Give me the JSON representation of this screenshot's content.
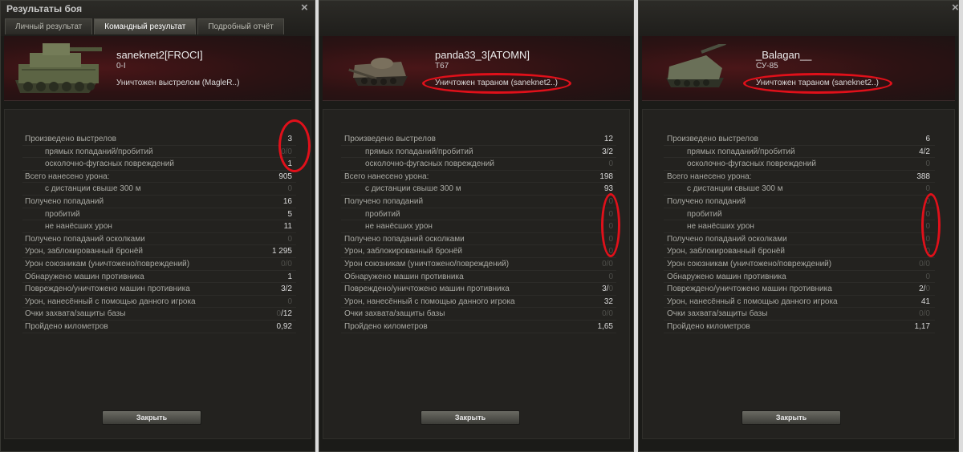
{
  "window": {
    "title": "Результаты боя",
    "close_icon": "×",
    "tabs": [
      {
        "label": "Личный результат",
        "active": false
      },
      {
        "label": "Командный результат",
        "active": true
      },
      {
        "label": "Подробный отчёт",
        "active": false
      }
    ]
  },
  "ui": {
    "close_label": "Закрыть"
  },
  "colors": {
    "highlight": "#e0101a",
    "header_red": "#4a1618"
  },
  "panels": [
    {
      "player": "saneknet2[FROCI]",
      "vehicle": "0-I",
      "vehicle_icon": "heavy-tank-icon",
      "fate": "Уничтожен выстрелом (MagleR..)",
      "stats": [
        {
          "label": "Произведено выстрелов",
          "indent": false,
          "value": "3",
          "dim": ""
        },
        {
          "label": "прямых попаданий/пробитий",
          "indent": true,
          "value": "",
          "dim": "0/0"
        },
        {
          "label": "осколочно-фугасных повреждений",
          "indent": true,
          "value": "1",
          "dim": ""
        },
        {
          "label": "Всего нанесено урона:",
          "indent": false,
          "value": "905",
          "dim": ""
        },
        {
          "label": "с дистанции свыше 300 м",
          "indent": true,
          "value": "",
          "dim": "0"
        },
        {
          "label": "Получено попаданий",
          "indent": false,
          "value": "16",
          "dim": ""
        },
        {
          "label": "пробитий",
          "indent": true,
          "value": "5",
          "dim": ""
        },
        {
          "label": "не нанёсших урон",
          "indent": true,
          "value": "11",
          "dim": ""
        },
        {
          "label": "Получено попаданий осколками",
          "indent": false,
          "value": "",
          "dim": "0"
        },
        {
          "label": "Урон, заблокированный бронёй",
          "indent": false,
          "value": "1 295",
          "dim": ""
        },
        {
          "label": "Урон союзникам (уничтожено/повреждений)",
          "indent": false,
          "value": "",
          "dim": "0/0"
        },
        {
          "label": "Обнаружено машин противника",
          "indent": false,
          "value": "1",
          "dim": ""
        },
        {
          "label": "Повреждено/уничтожено машин противника",
          "indent": false,
          "value": "3/2",
          "dim": ""
        },
        {
          "label": "Урон, нанесённый с помощью данного игрока",
          "indent": false,
          "value": "",
          "dim": "0"
        },
        {
          "label": "Очки захвата/защиты базы",
          "indent": false,
          "value": "/12",
          "dim": "0"
        },
        {
          "label": "Пройдено километров",
          "indent": false,
          "value": "0,92",
          "dim": ""
        }
      ]
    },
    {
      "player": "panda33_3[ATOMN]",
      "vehicle": "T67",
      "vehicle_icon": "tank-destroyer-icon",
      "fate": "Уничтожен тараном (saneknet2..)",
      "stats": [
        {
          "label": "Произведено выстрелов",
          "indent": false,
          "value": "12",
          "dim": ""
        },
        {
          "label": "прямых попаданий/пробитий",
          "indent": true,
          "value": "3/2",
          "dim": ""
        },
        {
          "label": "осколочно-фугасных повреждений",
          "indent": true,
          "value": "",
          "dim": "0"
        },
        {
          "label": "Всего нанесено урона:",
          "indent": false,
          "value": "198",
          "dim": ""
        },
        {
          "label": "с дистанции свыше 300 м",
          "indent": true,
          "value": "93",
          "dim": ""
        },
        {
          "label": "Получено попаданий",
          "indent": false,
          "value": "",
          "dim": "0"
        },
        {
          "label": "пробитий",
          "indent": true,
          "value": "",
          "dim": "0"
        },
        {
          "label": "не нанёсших урон",
          "indent": true,
          "value": "",
          "dim": "0"
        },
        {
          "label": "Получено попаданий осколками",
          "indent": false,
          "value": "",
          "dim": "0"
        },
        {
          "label": "Урон, заблокированный бронёй",
          "indent": false,
          "value": "",
          "dim": "0"
        },
        {
          "label": "Урон союзникам (уничтожено/повреждений)",
          "indent": false,
          "value": "",
          "dim": "0/0"
        },
        {
          "label": "Обнаружено машин противника",
          "indent": false,
          "value": "",
          "dim": "0"
        },
        {
          "label": "Повреждено/уничтожено машин противника",
          "indent": false,
          "value": "3/",
          "dim": "0"
        },
        {
          "label": "Урон, нанесённый с помощью данного игрока",
          "indent": false,
          "value": "32",
          "dim": ""
        },
        {
          "label": "Очки захвата/защиты базы",
          "indent": false,
          "value": "",
          "dim": "0/0"
        },
        {
          "label": "Пройдено километров",
          "indent": false,
          "value": "1,65",
          "dim": ""
        }
      ]
    },
    {
      "player": "_Balagan__",
      "vehicle": "СУ-85",
      "vehicle_icon": "self-propelled-gun-icon",
      "fate": "Уничтожен тараном (saneknet2..)",
      "stats": [
        {
          "label": "Произведено выстрелов",
          "indent": false,
          "value": "6",
          "dim": ""
        },
        {
          "label": "прямых попаданий/пробитий",
          "indent": true,
          "value": "4/2",
          "dim": ""
        },
        {
          "label": "осколочно-фугасных повреждений",
          "indent": true,
          "value": "",
          "dim": "0"
        },
        {
          "label": "Всего нанесено урона:",
          "indent": false,
          "value": "388",
          "dim": ""
        },
        {
          "label": "с дистанции свыше 300 м",
          "indent": true,
          "value": "",
          "dim": "0"
        },
        {
          "label": "Получено попаданий",
          "indent": false,
          "value": "",
          "dim": "0"
        },
        {
          "label": "пробитий",
          "indent": true,
          "value": "",
          "dim": "0"
        },
        {
          "label": "не нанёсших урон",
          "indent": true,
          "value": "",
          "dim": "0"
        },
        {
          "label": "Получено попаданий осколками",
          "indent": false,
          "value": "",
          "dim": "0"
        },
        {
          "label": "Урон, заблокированный бронёй",
          "indent": false,
          "value": "",
          "dim": "0"
        },
        {
          "label": "Урон союзникам (уничтожено/повреждений)",
          "indent": false,
          "value": "",
          "dim": "0/0"
        },
        {
          "label": "Обнаружено машин противника",
          "indent": false,
          "value": "",
          "dim": "0"
        },
        {
          "label": "Повреждено/уничтожено машин противника",
          "indent": false,
          "value": "2/",
          "dim": "0"
        },
        {
          "label": "Урон, нанесённый с помощью данного игрока",
          "indent": false,
          "value": "41",
          "dim": ""
        },
        {
          "label": "Очки захвата/защиты базы",
          "indent": false,
          "value": "",
          "dim": "0/0"
        },
        {
          "label": "Пройдено километров",
          "indent": false,
          "value": "1,17",
          "dim": ""
        }
      ]
    }
  ]
}
